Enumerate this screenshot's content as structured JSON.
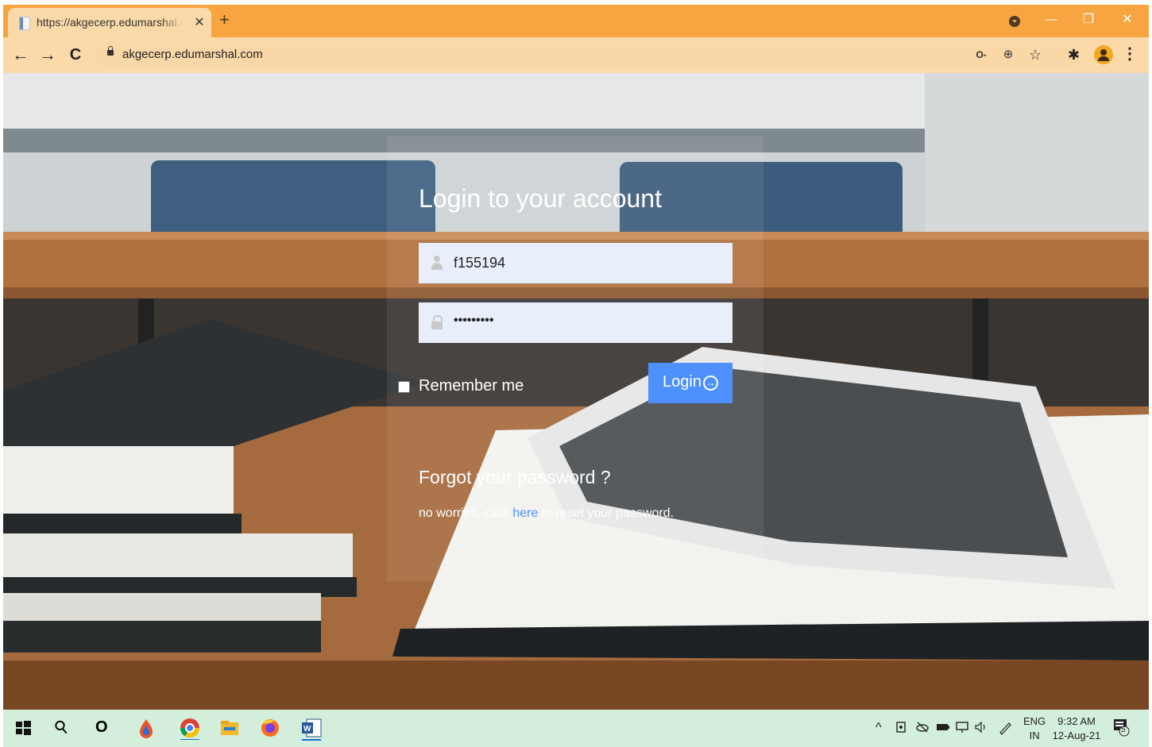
{
  "browser": {
    "tab_title": "https://akgecerp.edumarshal.com",
    "tab_close": "✕",
    "new_tab": "+",
    "url": "akgecerp.edumarshal.com",
    "window_controls": {
      "minimize": "—",
      "restore": "❐",
      "close": "✕"
    },
    "nav": {
      "back": "←",
      "forward": "→",
      "reload": "C"
    },
    "omnibox_icons": {
      "key": "O-",
      "zoom": "⊕",
      "bookmark": "☆"
    },
    "extensions": "✱",
    "menu": "⋮"
  },
  "login": {
    "title": "Login to your account",
    "username_value": "f155194",
    "password_value": "•••••••••",
    "remember_label": "Remember me",
    "remember_checked": false,
    "login_button": "Login",
    "login_arrow": "→",
    "forgot_title": "Forgot your password ?",
    "forgot_prefix": "no worries, click ",
    "forgot_link": "here",
    "forgot_suffix": " to reset your password."
  },
  "taskbar": {
    "search_icon": "⚲",
    "cortana_icon": "O",
    "tray_up": "^",
    "language": "ENG",
    "region": "IN",
    "time": "9:32 AM",
    "date": "12-Aug-21",
    "notification_count": "5"
  },
  "colors": {
    "titlebar": "#f6a540",
    "toolbar": "#fbd9a8",
    "login_button": "#4d90fe",
    "link": "#4d90fe",
    "taskbar": "#d3efdb"
  }
}
